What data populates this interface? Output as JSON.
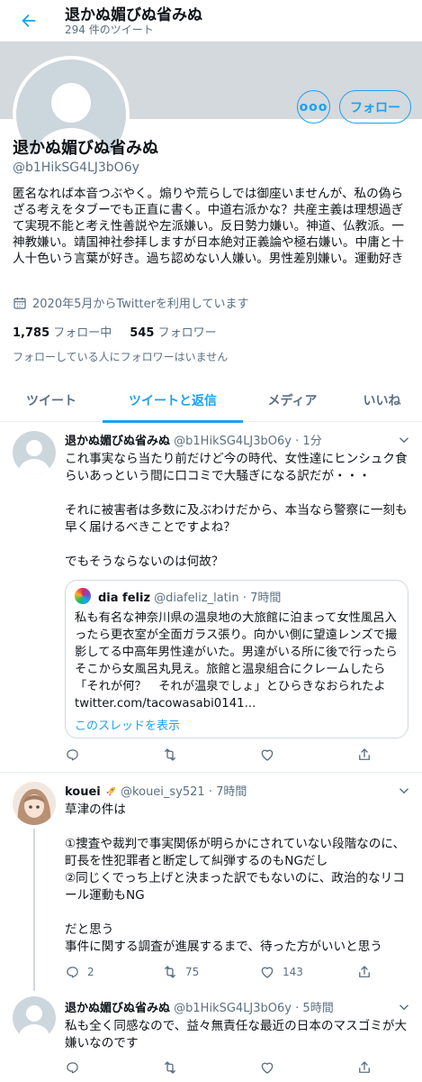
{
  "header": {
    "title": "退かぬ媚びぬ省みぬ",
    "tweet_count": "294 件のツイート"
  },
  "profile": {
    "name": "退かぬ媚びぬ省みぬ",
    "handle": "@b1HikSG4LJ3bO6y",
    "more_label": "ooo",
    "follow_label": "フォロー",
    "bio": "匿名なれば本音つぶやく。煽りや荒らしでは御座いませんが、私の偽らざる考えをタブーでも正直に書く。中道右派かな？共産主義は理想過ぎて実現不能と考え性善説や左派嫌い。反日勢力嫌い。神道、仏教派。一神教嫌い。靖国神社参拝しますが日本絶対正義論や極右嫌い。中庸と十人十色いう言葉が好き。過ち認めない人嫌い。男性差別嫌い。運動好き",
    "joined": "2020年5月からTwitterを利用しています",
    "following_count": "1,785",
    "following_label": "フォロー中",
    "followers_count": "545",
    "followers_label": "フォロワー",
    "no_mutual": "フォローしている人にフォロワーはいません"
  },
  "tabs": [
    {
      "label": "ツイート"
    },
    {
      "label": "ツイートと返信"
    },
    {
      "label": "メディア"
    },
    {
      "label": "いいね"
    }
  ],
  "tweets": [
    {
      "name": "退かぬ媚びぬ省みぬ",
      "handle": "@b1HikSG4LJ3bO6y",
      "dot": "·",
      "time": "1分",
      "text": "これ事実なら当たり前だけど今の時代、女性達にヒンシュク食らいあっという間に口コミで大騒ぎになる訳だが・・・\n\nそれに被害者は多数に及ぶわけだから、本当なら警察に一刻も早く届けるべきことですよね？\n\nでもそうならないのは何故？",
      "quote": {
        "name": "dia feliz",
        "handle": "@diafeliz_latin",
        "dot": "·",
        "time": "7時間",
        "text": "私も有名な神奈川県の温泉地の大旅館に泊まって女性風呂入ったら更衣室が全面ガラス張り。向かい側に望遠レンズで撮影してる中高年男性達がいた。男達がいる所に後で行ったらそこから女風呂丸見え。旅館と温泉組合にクレームしたら「それが何？　それが温泉でしょ」とひらきなおられたよ twitter.com/tacowasabi0141...",
        "thread_link": "このスレッドを表示"
      },
      "replies": "",
      "retweets": "",
      "likes": ""
    },
    {
      "name": "kouei",
      "handle": "@kouei_sy521",
      "dot": "·",
      "time": "7時間",
      "text": "草津の件は\n\n①捜査や裁判で事実関係が明らかにされていない段階なのに、町長を性犯罪者と断定して糾弾するのもNGだし\n②同じくでっち上げと決まった訳でもないのに、政治的なリコール運動もNG\n\nだと思う\n事件に関する調査が進展するまで、待った方がいいと思う",
      "replies": "2",
      "retweets": "75",
      "likes": "143"
    },
    {
      "name": "退かぬ媚びぬ省みぬ",
      "handle": "@b1HikSG4LJ3bO6y",
      "dot": "·",
      "time": "5時間",
      "text": "私も全く同感なので、益々無責任な最近の日本のマスゴミが大嫌いなのです",
      "replies": "",
      "retweets": "",
      "likes": ""
    }
  ],
  "icons": {
    "back": "arrow-left-icon",
    "calendar": "calendar-icon",
    "reply": "reply-icon",
    "retweet": "retweet-icon",
    "like": "heart-icon",
    "share": "share-icon",
    "caret": "chevron-down-icon"
  },
  "colors": {
    "accent": "#1da1f2",
    "secondary_text": "#5b7083",
    "banner": "#d4d9dd"
  }
}
